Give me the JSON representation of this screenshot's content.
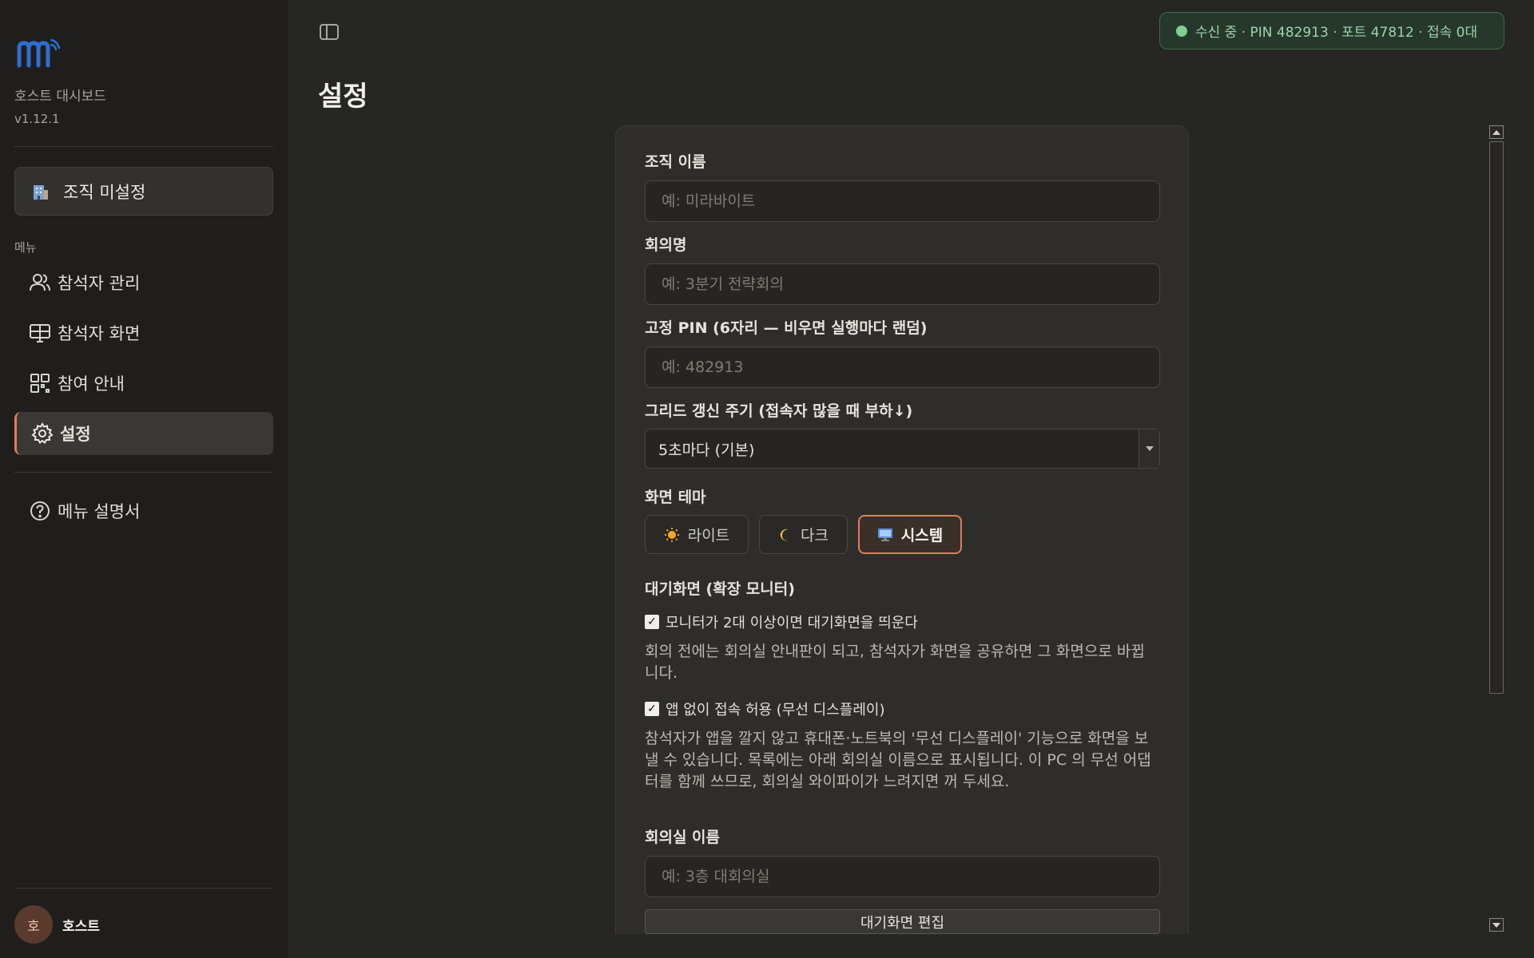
{
  "sidebar": {
    "app_name": "호스트 대시보드",
    "version": "v1.12.1",
    "org_button": "조직 미설정",
    "menu_label": "메뉴",
    "items": [
      {
        "label": "참석자 관리",
        "icon": "users-icon"
      },
      {
        "label": "참석자 화면",
        "icon": "screens-icon"
      },
      {
        "label": "참여 안내",
        "icon": "qr-icon"
      },
      {
        "label": "설정",
        "icon": "gear-icon",
        "active": true
      }
    ],
    "help": "메뉴 설명서",
    "user": {
      "avatar": "호",
      "name": "호스트"
    }
  },
  "header": {
    "status": "수신 중 · PIN 482913 · 포트 47812 · 접속 0대"
  },
  "page_title": "설정",
  "form": {
    "org_name": {
      "label": "조직 이름",
      "placeholder": "예: 미라바이트",
      "value": ""
    },
    "meeting_name": {
      "label": "회의명",
      "placeholder": "예: 3분기 전략회의",
      "value": ""
    },
    "fixed_pin": {
      "label": "고정 PIN (6자리 — 비우면 실행마다 랜덤)",
      "placeholder": "예: 482913",
      "value": ""
    },
    "grid_refresh": {
      "label": "그리드 갱신 주기 (접속자 많을 때 부하↓)",
      "value": "5초마다 (기본)"
    },
    "theme": {
      "label": "화면 테마",
      "options": [
        {
          "label": "라이트",
          "icon": "sun-icon"
        },
        {
          "label": "다크",
          "icon": "moon-icon"
        },
        {
          "label": "시스템",
          "icon": "monitor-icon",
          "selected": true
        }
      ]
    },
    "standby": {
      "label": "대기화면 (확장 모니터)",
      "check1": {
        "label": "모니터가 2대 이상이면 대기화면을 띄운다",
        "checked": true
      },
      "desc1": "회의 전에는 회의실 안내판이 되고, 참석자가 화면을 공유하면 그 화면으로 바뀝니다.",
      "check2": {
        "label": "앱 없이 접속 허용 (무선 디스플레이)",
        "checked": true
      },
      "desc2": "참석자가 앱을 깔지 않고 휴대폰·노트북의 '무선 디스플레이' 기능으로 화면을 보낼 수 있습니다. 목록에는 아래 회의실 이름으로 표시됩니다. 이 PC 의 무선 어댑터를 함께 쓰므로, 회의실 와이파이가 느려지면 꺼 두세요.",
      "room_name": {
        "label": "회의실 이름",
        "placeholder": "예: 3층 대회의실",
        "value": ""
      },
      "edit_button": "대기화면 편집"
    }
  },
  "colors": {
    "accent": "#d9805f",
    "status_green": "#7fd08e"
  }
}
